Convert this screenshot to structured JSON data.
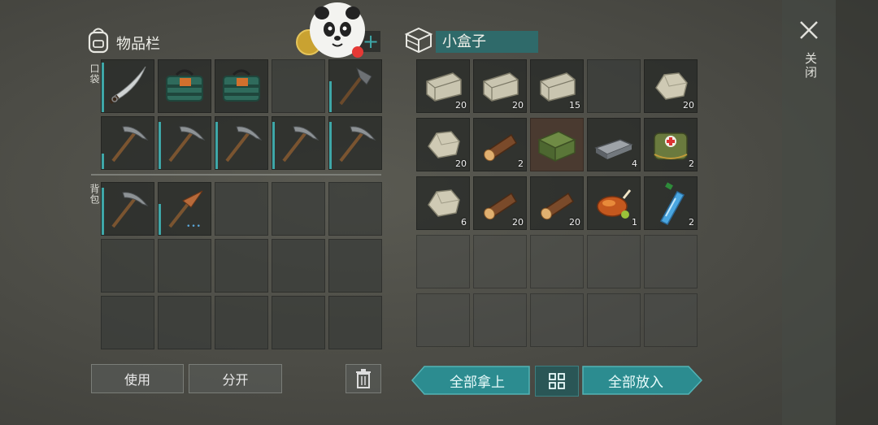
{
  "inventory": {
    "title": "物品栏",
    "pocket_label": "口袋",
    "backpack_label": "背包"
  },
  "container": {
    "title": "小盒子"
  },
  "buttons": {
    "use": "使用",
    "split": "分开",
    "take_all": "全部拿上",
    "put_all": "全部放入"
  },
  "close": {
    "label": "关闭"
  },
  "colors": {
    "accent": "#2c8c90",
    "durability": "#3ea7a8",
    "badge": "#e53935"
  },
  "pocket_slots": [
    {
      "item": "machete",
      "durability": 0.95
    },
    {
      "item": "backpack-bundle"
    },
    {
      "item": "backpack-bundle"
    },
    {
      "item": "empty"
    },
    {
      "item": "hatchet",
      "durability": 0.6
    },
    {
      "item": "pickaxe",
      "durability": 0.3
    },
    {
      "item": "pickaxe",
      "durability": 0.9
    },
    {
      "item": "pickaxe",
      "durability": 0.9
    },
    {
      "item": "pickaxe",
      "durability": 0.9
    },
    {
      "item": "pickaxe",
      "durability": 0.9
    }
  ],
  "backpack_slots": [
    {
      "item": "pickaxe",
      "durability": 0.9
    },
    {
      "item": "pickaxe-copper",
      "durability": 0.6,
      "dots": "•••"
    }
  ],
  "container_slots": [
    {
      "item": "stone-block",
      "qty": "20"
    },
    {
      "item": "stone-block",
      "qty": "20"
    },
    {
      "item": "stone-block",
      "qty": "15"
    },
    {
      "item": "empty"
    },
    {
      "item": "stone",
      "qty": "20"
    },
    {
      "item": "stone",
      "qty": "20"
    },
    {
      "item": "log",
      "qty": "2"
    },
    {
      "item": "ammo-crate",
      "qty": ""
    },
    {
      "item": "iron-ingot",
      "qty": "4"
    },
    {
      "item": "medkit-bag",
      "qty": "2"
    },
    {
      "item": "stone",
      "qty": "6"
    },
    {
      "item": "log",
      "qty": "20"
    },
    {
      "item": "log",
      "qty": "20"
    },
    {
      "item": "roast-chicken",
      "qty": "1"
    },
    {
      "item": "water-bottle",
      "qty": "2"
    }
  ]
}
